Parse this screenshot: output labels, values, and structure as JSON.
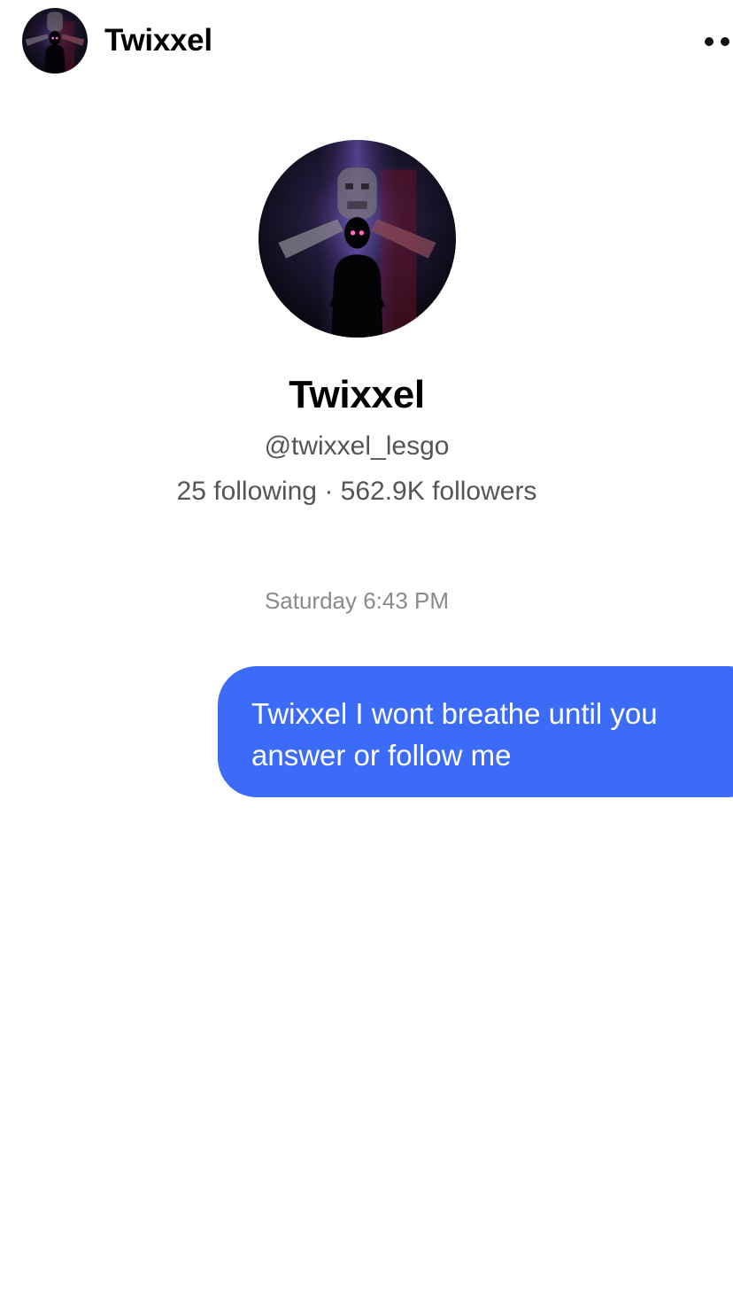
{
  "header": {
    "name": "Twixxel",
    "avatar_icon": "profile-avatar-image",
    "more_icon": "more-options-dots-icon"
  },
  "profile": {
    "name": "Twixxel",
    "handle": "@twixxel_lesgo",
    "stats": "25 following · 562.9K followers"
  },
  "conversation": {
    "timestamp": "Saturday 6:43 PM",
    "messages": [
      {
        "sender": "me",
        "text": "Twixxel I wont breathe until you\nanswer or follow me"
      }
    ]
  },
  "colors": {
    "bubble_sent": "#3c6cf7",
    "secondary_text": "#555555",
    "timestamp_text": "#8a8a8a"
  }
}
